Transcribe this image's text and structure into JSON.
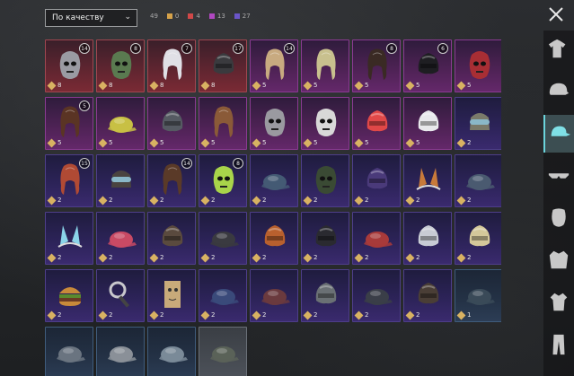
{
  "sort": {
    "label": "По качеству",
    "chevron": "chevron-down-icon"
  },
  "counts": {
    "total": "49",
    "items": [
      {
        "color": "#d6a24a",
        "value": "0"
      },
      {
        "color": "#d04848",
        "value": "4"
      },
      {
        "color": "#b048c0",
        "value": "13"
      },
      {
        "color": "#6a55c8",
        "value": "27"
      }
    ]
  },
  "close_icon": "close-icon",
  "items": [
    {
      "rarity": "red",
      "icon": "mask-icon",
      "value": "8",
      "level": "14",
      "color": "#9a9aa2"
    },
    {
      "rarity": "red",
      "icon": "zombie-mask-icon",
      "value": "8",
      "level": "8",
      "color": "#5a7a50"
    },
    {
      "rarity": "red",
      "icon": "white-hair-icon",
      "value": "8",
      "level": "7",
      "color": "#e0e0e6"
    },
    {
      "rarity": "red",
      "icon": "helmet-icon",
      "value": "8",
      "level": "17",
      "color": "#3a3a3e"
    },
    {
      "rarity": "pink",
      "icon": "hair-icon",
      "value": "5",
      "level": "14",
      "color": "#c8aa80"
    },
    {
      "rarity": "pink",
      "icon": "hair-icon",
      "value": "5",
      "color": "#c8c08e"
    },
    {
      "rarity": "pink",
      "icon": "dark-hair-icon",
      "value": "5",
      "level": "8",
      "color": "#3a2a24"
    },
    {
      "rarity": "pink",
      "icon": "black-helmet-icon",
      "value": "5",
      "level": "6",
      "color": "#1e1e22"
    },
    {
      "rarity": "pink",
      "icon": "red-mask-icon",
      "value": "5",
      "color": "#a82e34"
    },
    {
      "rarity": "pink",
      "icon": "brown-hair-icon",
      "value": "5",
      "level": "5",
      "color": "#5a3424"
    },
    {
      "rarity": "pink",
      "icon": "yellow-cap-icon",
      "value": "5",
      "color": "#c8c044"
    },
    {
      "rarity": "pink",
      "icon": "visor-helmet-icon",
      "value": "5",
      "color": "#555a62"
    },
    {
      "rarity": "pink",
      "icon": "bun-hair-icon",
      "value": "5",
      "color": "#8a5a38"
    },
    {
      "rarity": "pink",
      "icon": "wolf-mask-icon",
      "value": "5",
      "color": "#9a9aa0"
    },
    {
      "rarity": "pink",
      "icon": "zebra-mask-icon",
      "value": "5",
      "color": "#d8d8d8"
    },
    {
      "rarity": "pink",
      "icon": "crab-hat-icon",
      "value": "5",
      "color": "#e04848"
    },
    {
      "rarity": "pink",
      "icon": "white-hat-icon",
      "value": "5",
      "color": "#e8e8ec"
    },
    {
      "rarity": "purple",
      "icon": "helmet-goggles-icon",
      "value": "2",
      "color": "#7a7a6a"
    },
    {
      "rarity": "purple",
      "icon": "witch-hair-icon",
      "value": "2",
      "level": "15",
      "color": "#b04a34"
    },
    {
      "rarity": "purple",
      "icon": "goggles-icon",
      "value": "2",
      "color": "#4a4440"
    },
    {
      "rarity": "purple",
      "icon": "long-hair-icon",
      "value": "2",
      "level": "14",
      "color": "#5a3a28"
    },
    {
      "rarity": "purple",
      "icon": "skull-hood-icon",
      "value": "2",
      "level": "8",
      "color": "#a8d44a"
    },
    {
      "rarity": "purple",
      "icon": "cap-icon",
      "value": "2",
      "color": "#445a74"
    },
    {
      "rarity": "purple",
      "icon": "gas-mask-icon",
      "value": "2",
      "color": "#3a4a34"
    },
    {
      "rarity": "purple",
      "icon": "jester-hat-icon",
      "value": "2",
      "color": "#4a3a7a"
    },
    {
      "rarity": "purple",
      "icon": "ears-icon",
      "value": "2",
      "color": "#c87a3a"
    },
    {
      "rarity": "purple",
      "icon": "cap-icon",
      "value": "2",
      "color": "#4a5a70"
    },
    {
      "rarity": "purple",
      "icon": "bunny-ears-icon",
      "value": "2",
      "color": "#8ad4e8"
    },
    {
      "rarity": "purple",
      "icon": "beret-icon",
      "value": "2",
      "color": "#c84a64"
    },
    {
      "rarity": "purple",
      "icon": "pilot-helmet-icon",
      "value": "2",
      "color": "#5a4a3e"
    },
    {
      "rarity": "purple",
      "icon": "cap-icon",
      "value": "2",
      "color": "#3a3a40"
    },
    {
      "rarity": "purple",
      "icon": "football-helmet-icon",
      "value": "2",
      "color": "#b8602e"
    },
    {
      "rarity": "purple",
      "icon": "biker-helmet-icon",
      "value": "2",
      "color": "#2a2a30"
    },
    {
      "rarity": "purple",
      "icon": "beret-icon",
      "value": "2",
      "color": "#a83a3a"
    },
    {
      "rarity": "purple",
      "icon": "shark-hat-icon",
      "value": "2",
      "color": "#c8ccd4"
    },
    {
      "rarity": "purple",
      "icon": "knit-hat-icon",
      "value": "2",
      "color": "#d4c89a"
    },
    {
      "rarity": "purple",
      "icon": "burger-hat-icon",
      "value": "2",
      "color": "#c88a3a"
    },
    {
      "rarity": "purple",
      "icon": "magnifier-icon",
      "value": "2",
      "color": "#c8c8cc"
    },
    {
      "rarity": "purple",
      "icon": "paper-bag-icon",
      "value": "2",
      "color": "#c8aa7a"
    },
    {
      "rarity": "purple",
      "icon": "garrison-cap-icon",
      "value": "2",
      "color": "#3a4a7a"
    },
    {
      "rarity": "purple",
      "icon": "fedora-icon",
      "value": "2",
      "color": "#6a3a3e"
    },
    {
      "rarity": "purple",
      "icon": "net-helmet-icon",
      "value": "2",
      "color": "#6a7074"
    },
    {
      "rarity": "purple",
      "icon": "bucket-hat-icon",
      "value": "2",
      "color": "#3a3e48"
    },
    {
      "rarity": "purple",
      "icon": "aviator-hat-icon",
      "value": "2",
      "color": "#4a3e36"
    },
    {
      "rarity": "blue",
      "icon": "flat-cap-icon",
      "value": "1",
      "color": "#3a4a58"
    },
    {
      "rarity": "blue",
      "icon": "flat-cap-icon",
      "value": "",
      "color": "#6a7480"
    },
    {
      "rarity": "blue",
      "icon": "cap-icon",
      "value": "",
      "color": "#8a9098"
    },
    {
      "rarity": "blue",
      "icon": "cap-icon",
      "value": "",
      "color": "#7a8a98"
    },
    {
      "rarity": "gray",
      "icon": "camo-cap-icon",
      "value": "",
      "color": "#5a6258"
    }
  ],
  "sidebar": [
    {
      "name": "tab-outfit",
      "icon": "outfit-icon"
    },
    {
      "name": "tab-helmet",
      "icon": "helmet-icon"
    },
    {
      "name": "tab-hat",
      "icon": "cap-icon"
    },
    {
      "name": "tab-glasses",
      "icon": "glasses-icon"
    },
    {
      "name": "tab-mask",
      "icon": "mask-icon"
    },
    {
      "name": "tab-jacket",
      "icon": "jacket-icon"
    },
    {
      "name": "tab-shirt",
      "icon": "shirt-icon"
    },
    {
      "name": "tab-pants",
      "icon": "pants-icon"
    }
  ],
  "active_tab": 2
}
